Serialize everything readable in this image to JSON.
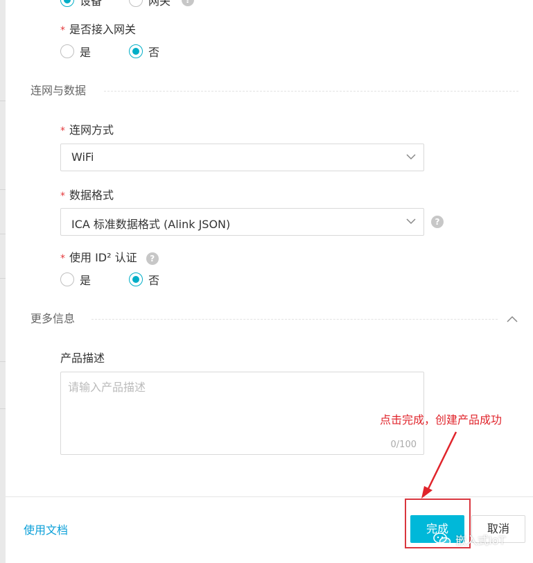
{
  "node_type": {
    "options": [
      {
        "label": "设备",
        "checked": true
      },
      {
        "label": "网关",
        "checked": false
      }
    ]
  },
  "gateway_access": {
    "label": "是否接入网关",
    "required": "*",
    "options": [
      {
        "label": "是",
        "checked": false
      },
      {
        "label": "否",
        "checked": true
      }
    ]
  },
  "section_network": {
    "title": "连网与数据"
  },
  "network_method": {
    "label": "连网方式",
    "required": "*",
    "value": "WiFi"
  },
  "data_format": {
    "label": "数据格式",
    "required": "*",
    "value": "ICA 标准数据格式 (Alink JSON)"
  },
  "id2_auth": {
    "label": "使用 ID² 认证",
    "required": "*",
    "options": [
      {
        "label": "是",
        "checked": false
      },
      {
        "label": "否",
        "checked": true
      }
    ]
  },
  "section_more": {
    "title": "更多信息"
  },
  "product_desc": {
    "label": "产品描述",
    "placeholder": "请输入产品描述",
    "counter": "0/100"
  },
  "footer": {
    "doc_link": "使用文档",
    "confirm": "完成",
    "cancel": "取消"
  },
  "annotation": {
    "text": "点击完成，创建产品成功",
    "color": "#e0242b"
  },
  "watermark": {
    "text": "嵌入式IoT"
  },
  "colors": {
    "accent": "#00b8d9",
    "link": "#0a9fd8",
    "required": "#e4393c"
  }
}
